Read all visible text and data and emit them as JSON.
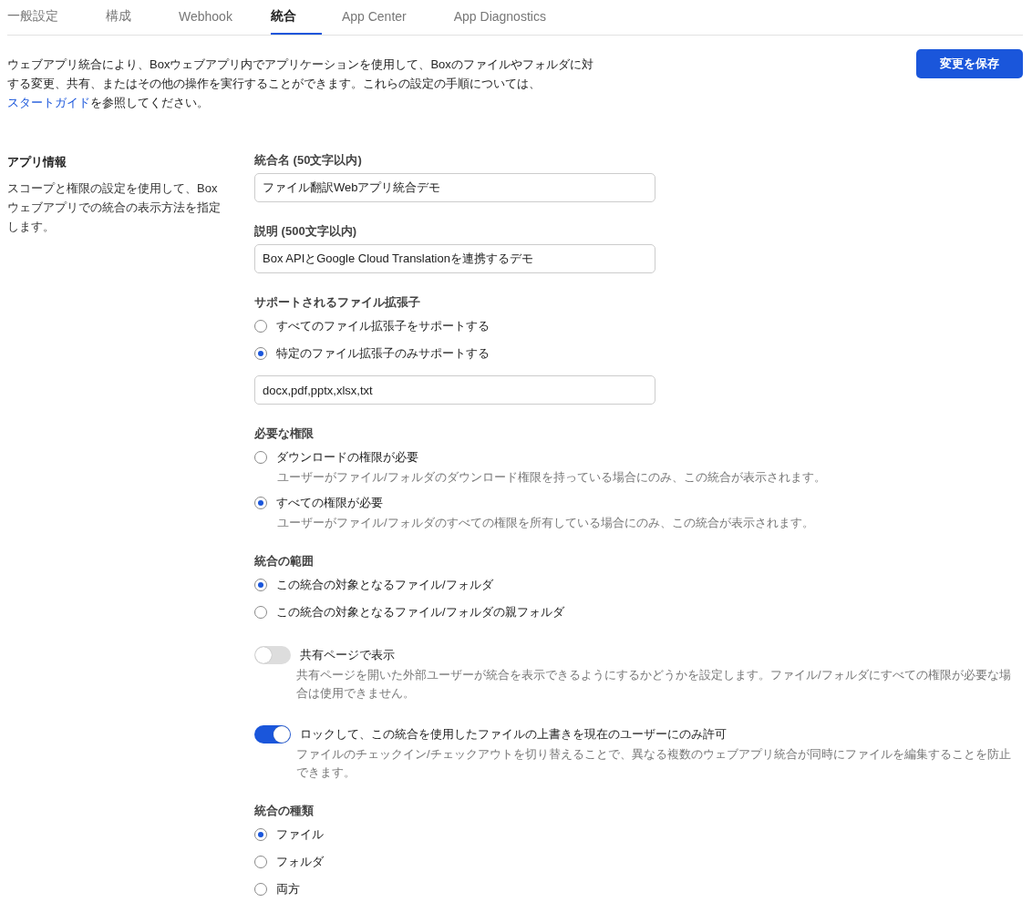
{
  "tabs": [
    {
      "label": "一般設定",
      "selected": false
    },
    {
      "label": "構成",
      "selected": false
    },
    {
      "label": "Webhook",
      "selected": false
    },
    {
      "label": "統合",
      "selected": true
    },
    {
      "label": "App Center",
      "selected": false
    },
    {
      "label": "App Diagnostics",
      "selected": false
    }
  ],
  "intro": {
    "before": "ウェブアプリ統合により、Boxウェブアプリ内でアプリケーションを使用して、Boxのファイルやフォルダに対する変更、共有、またはその他の操作を実行することができます。これらの設定の手順については、",
    "link": "スタートガイド",
    "after": "を参照してください。"
  },
  "save_button": "変更を保存",
  "section": {
    "title": "アプリ情報",
    "description": "スコープと権限の設定を使用して、Boxウェブアプリでの統合の表示方法を指定します。"
  },
  "form": [
    {
      "kind": "text_field",
      "label": "統合名 (50文字以内)",
      "value": "ファイル翻訳Webアプリ統合デモ"
    },
    {
      "kind": "text_field",
      "label": "説明 (500文字以内)",
      "value": "Box APIとGoogle Cloud Translationを連携するデモ"
    },
    {
      "kind": "radio_group",
      "label": "サポートされるファイル拡張子",
      "options": [
        {
          "label": "すべてのファイル拡張子をサポートする",
          "selected": false
        },
        {
          "label": "特定のファイル拡張子のみサポートする",
          "selected": true
        }
      ],
      "field_value": "docx,pdf,pptx,xlsx,txt"
    },
    {
      "kind": "radio_group",
      "label": "必要な権限",
      "options": [
        {
          "label": "ダウンロードの権限が必要",
          "hint": "ユーザーがファイル/フォルダのダウンロード権限を持っている場合にのみ、この統合が表示されます。",
          "selected": false
        },
        {
          "label": "すべての権限が必要",
          "hint": "ユーザーがファイル/フォルダのすべての権限を所有している場合にのみ、この統合が表示されます。",
          "selected": true
        }
      ]
    },
    {
      "kind": "radio_group",
      "label": "統合の範囲",
      "options": [
        {
          "label": "この統合の対象となるファイル/フォルダ",
          "selected": true
        },
        {
          "label": "この統合の対象となるファイル/フォルダの親フォルダ",
          "selected": false
        }
      ]
    },
    {
      "kind": "toggle",
      "label": "共有ページで表示",
      "hint": "共有ページを開いた外部ユーザーが統合を表示できるようにするかどうかを設定します。ファイル/フォルダにすべての権限が必要な場合は使用できません。",
      "on": false
    },
    {
      "kind": "toggle",
      "label": "ロックして、この統合を使用したファイルの上書きを現在のユーザーにのみ許可",
      "hint": "ファイルのチェックイン/チェックアウトを切り替えることで、異なる複数のウェブアプリ統合が同時にファイルを編集することを防止できます。",
      "on": true
    },
    {
      "kind": "radio_group",
      "label": "統合の種類",
      "options": [
        {
          "label": "ファイル",
          "selected": true
        },
        {
          "label": "フォルダ",
          "selected": false
        },
        {
          "label": "両方",
          "selected": false
        }
      ]
    }
  ]
}
